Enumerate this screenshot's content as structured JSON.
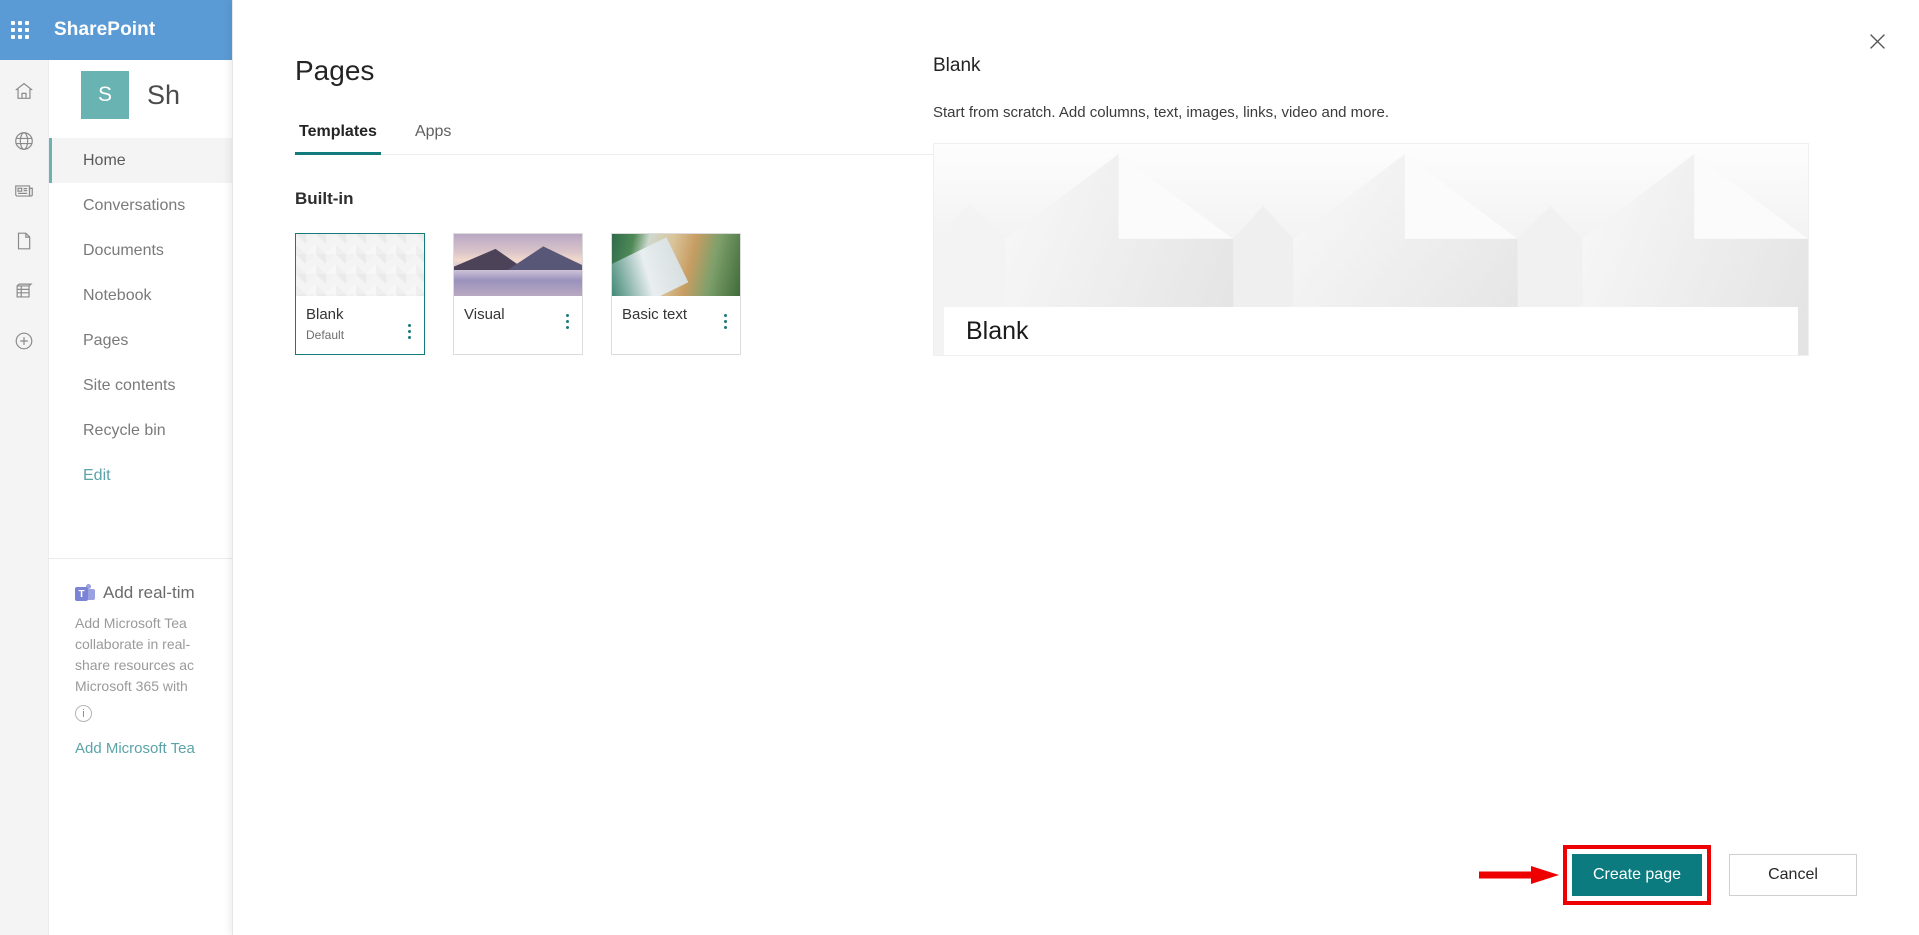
{
  "suite": {
    "waffle_icon": "app-launcher-icon",
    "title": "SharePoint"
  },
  "rail": {
    "items": [
      {
        "icon": "home-icon",
        "name": "home"
      },
      {
        "icon": "globe-icon",
        "name": "my-sites"
      },
      {
        "icon": "news-icon",
        "name": "news"
      },
      {
        "icon": "document-icon",
        "name": "files"
      },
      {
        "icon": "list-icon",
        "name": "lists"
      },
      {
        "icon": "plus-circle-icon",
        "name": "create"
      }
    ]
  },
  "site": {
    "logo_letter": "S",
    "name": "Sh",
    "nav_items": [
      {
        "label": "Home",
        "active": true
      },
      {
        "label": "Conversations",
        "active": false
      },
      {
        "label": "Documents",
        "active": false
      },
      {
        "label": "Notebook",
        "active": false
      },
      {
        "label": "Pages",
        "active": false
      },
      {
        "label": "Site contents",
        "active": false
      },
      {
        "label": "Recycle bin",
        "active": false
      }
    ],
    "edit_label": "Edit"
  },
  "promo": {
    "teams_letter": "T",
    "heading": "Add real-tim",
    "line1": "Add Microsoft Tea",
    "line2": "collaborate in real-",
    "line3": "share resources ac",
    "line4": "Microsoft 365 with",
    "info_icon": "info-icon",
    "link": "Add Microsoft Tea"
  },
  "modal": {
    "close_icon": "close-icon",
    "title": "Pages",
    "tabs": [
      {
        "label": "Templates",
        "active": true
      },
      {
        "label": "Apps",
        "active": false
      }
    ],
    "section_title": "Built-in",
    "cards": [
      {
        "name": "Blank",
        "sub": "Default",
        "thumb": "thumb-blank",
        "selected": true,
        "kebab": "more-options-icon"
      },
      {
        "name": "Visual",
        "sub": "",
        "thumb": "thumb-visual",
        "selected": false,
        "kebab": "more-options-icon"
      },
      {
        "name": "Basic text",
        "sub": "",
        "thumb": "thumb-basic",
        "selected": false,
        "kebab": "more-options-icon"
      }
    ],
    "preview": {
      "title": "Blank",
      "description": "Start from scratch. Add columns, text, images, links, video and more.",
      "hero_title": "Blank"
    },
    "footer": {
      "create_label": "Create page",
      "cancel_label": "Cancel"
    }
  },
  "annotation": {
    "highlight_color": "#ef0000",
    "arrow_name": "red-arrow-annotation"
  },
  "colors": {
    "suite_blue": "#5b9bd5",
    "site_teal": "#69b3b2",
    "accent_teal": "#0c7b80",
    "tab_underline": "#137b7b"
  }
}
